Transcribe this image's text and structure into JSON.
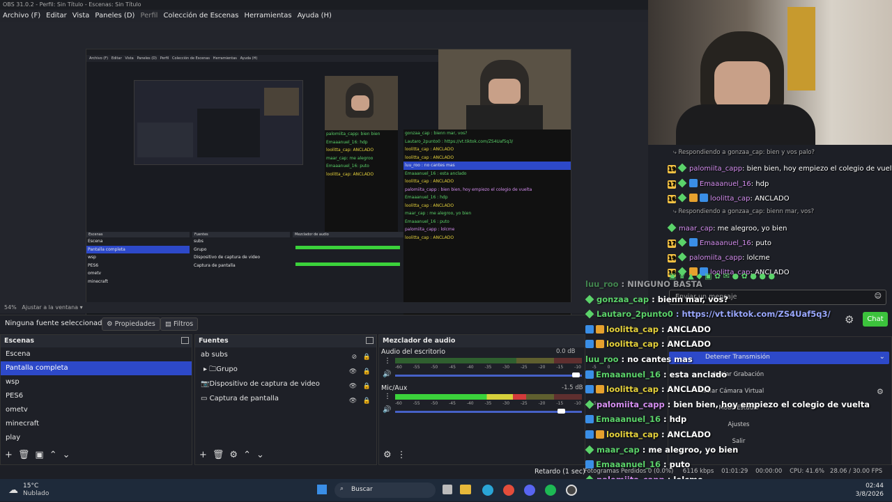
{
  "window": {
    "title": "OBS 31.0.2 - Perfil: Sin Título - Escenas: Sin Título"
  },
  "menu": [
    "Archivo (F)",
    "Editar",
    "Vista",
    "Paneles (D)",
    "Perfil",
    "Colección de Escenas",
    "Herramientas",
    "Ayuda (H)"
  ],
  "preview": {
    "zoom": "54%",
    "fit": "Ajustar a la ventana"
  },
  "sourcebar": {
    "no_source": "Ninguna fuente seleccionada",
    "properties": "Propiedades",
    "filters": "Filtros"
  },
  "scenes": {
    "title": "Escenas",
    "items": [
      "Escena",
      "Pantalla completa",
      "wsp",
      "PES6",
      "ometv",
      "minecraft",
      "play"
    ],
    "selected": 1
  },
  "sources": {
    "title": "Fuentes",
    "items": [
      {
        "label": "subs",
        "icon": "text-icon"
      },
      {
        "label": "Grupo",
        "icon": "folder-icon"
      },
      {
        "label": "Dispositivo de captura de video",
        "icon": "camera-icon"
      },
      {
        "label": "Captura de pantalla",
        "icon": "monitor-icon"
      }
    ]
  },
  "mixer": {
    "title": "Mezclador de audio",
    "channels": [
      {
        "name": "Audio del escritorio",
        "db": "0.0 dB",
        "level": 0.0,
        "volume": 0.97
      },
      {
        "name": "Mic/Aux",
        "db": "-1.5 dB",
        "level": 0.7,
        "volume": 0.89
      }
    ],
    "ticks": [
      "-60",
      "-55",
      "-50",
      "-45",
      "-40",
      "-35",
      "-30",
      "-25",
      "-20",
      "-15",
      "-10",
      "-5",
      "0"
    ]
  },
  "status": {
    "delay": "Retardo (1 sec)",
    "frames_lost": "Fotogramas Perdidos 0 (0.0%)",
    "bitrate": "6116 kbps",
    "time1": "01:01:29",
    "time2": "00:00:00",
    "cpu": "CPU: 41.6%",
    "fps": "28.06 / 30.00 FPS"
  },
  "controls": {
    "stop_stream": "Detener Transmisión",
    "start_rec": "Iniciar Grabación",
    "virtual_cam": "Iniciar Cámara Virtual",
    "studio": "Modo Estudio",
    "settings": "Ajustes",
    "exit": "Salir"
  },
  "overlay": {
    "lines": [
      {
        "type": "reply",
        "text": "Respondiendo a gonzaa_cap: bien y vos palo?"
      },
      {
        "type": "msg",
        "badge": "19",
        "user": "palomiita_capp",
        "text": "bien bien, hoy empiezo el colegio de vuelta"
      },
      {
        "type": "msg",
        "badge": "17",
        "user": "Emaaanuel_16",
        "text": "hdp"
      },
      {
        "type": "msg",
        "badge": "16",
        "user": "loolitta_cap",
        "text": "ANCLADO"
      },
      {
        "type": "reply",
        "text": "Respondiendo a gonzaa_cap: bienn mar, vos?"
      },
      {
        "type": "msg",
        "badge": "",
        "user": "maar_cap",
        "text": "me alegroo, yo bien"
      },
      {
        "type": "msg",
        "badge": "17",
        "user": "Emaaanuel_16",
        "text": "puto"
      },
      {
        "type": "msg",
        "badge": "19",
        "user": "palomiita_capp",
        "text": "lolcme"
      },
      {
        "type": "msg",
        "badge": "16",
        "user": "loolitta_cap",
        "text": "ANCLADO"
      }
    ],
    "input_placeholder": "Enviar un mensaje",
    "chat_button": "Chat"
  },
  "chat": [
    {
      "user": "luu_roo",
      "text": "NINGUNO BASTA",
      "color": "#5bd36a",
      "faded": true
    },
    {
      "user": "gonzaa_cap",
      "text": "bienn mar, vos?",
      "color": "#5bd36a"
    },
    {
      "user": "Lautaro_2punto0",
      "text": "https://vt.tiktok.com/ZS4Uaf5q3/",
      "color": "#5bd36a",
      "link": true
    },
    {
      "user": "loolitta_cap",
      "text": "ANCLADO",
      "color": "#e6d23b"
    },
    {
      "user": "loolitta_cap",
      "text": "ANCLADO",
      "color": "#e6d23b"
    },
    {
      "user": "luu_roo",
      "text": "no cantes mas",
      "color": "#5bd36a"
    },
    {
      "user": "Emaaanuel_16",
      "text": "esta anclado",
      "color": "#5bd36a"
    },
    {
      "user": "loolitta_cap",
      "text": "ANCLADO",
      "color": "#e6d23b"
    },
    {
      "user": "palomiita_capp",
      "text": "bien bien, hoy empiezo el colegio de vuelta",
      "color": "#d58ef0"
    },
    {
      "user": "Emaaanuel_16",
      "text": "hdp",
      "color": "#5bd36a"
    },
    {
      "user": "loolitta_cap",
      "text": "ANCLADO",
      "color": "#e6d23b"
    },
    {
      "user": "maar_cap",
      "text": "me alegroo, yo bien",
      "color": "#5bd36a"
    },
    {
      "user": "Emaaanuel_16",
      "text": "puto",
      "color": "#5bd36a"
    },
    {
      "user": "palomiita_capp",
      "text": "lolcme",
      "color": "#d58ef0"
    },
    {
      "user": "loolitta_cap",
      "text": "ANCLADO",
      "color": "#e6d23b"
    }
  ],
  "taskbar": {
    "weather_temp": "15°C",
    "weather_desc": "Nublado",
    "search": "Buscar",
    "time": "02:44",
    "date": "3/8/2026"
  },
  "colors": {
    "accent": "#2d49c9",
    "chat_button": "#3cc33c"
  }
}
